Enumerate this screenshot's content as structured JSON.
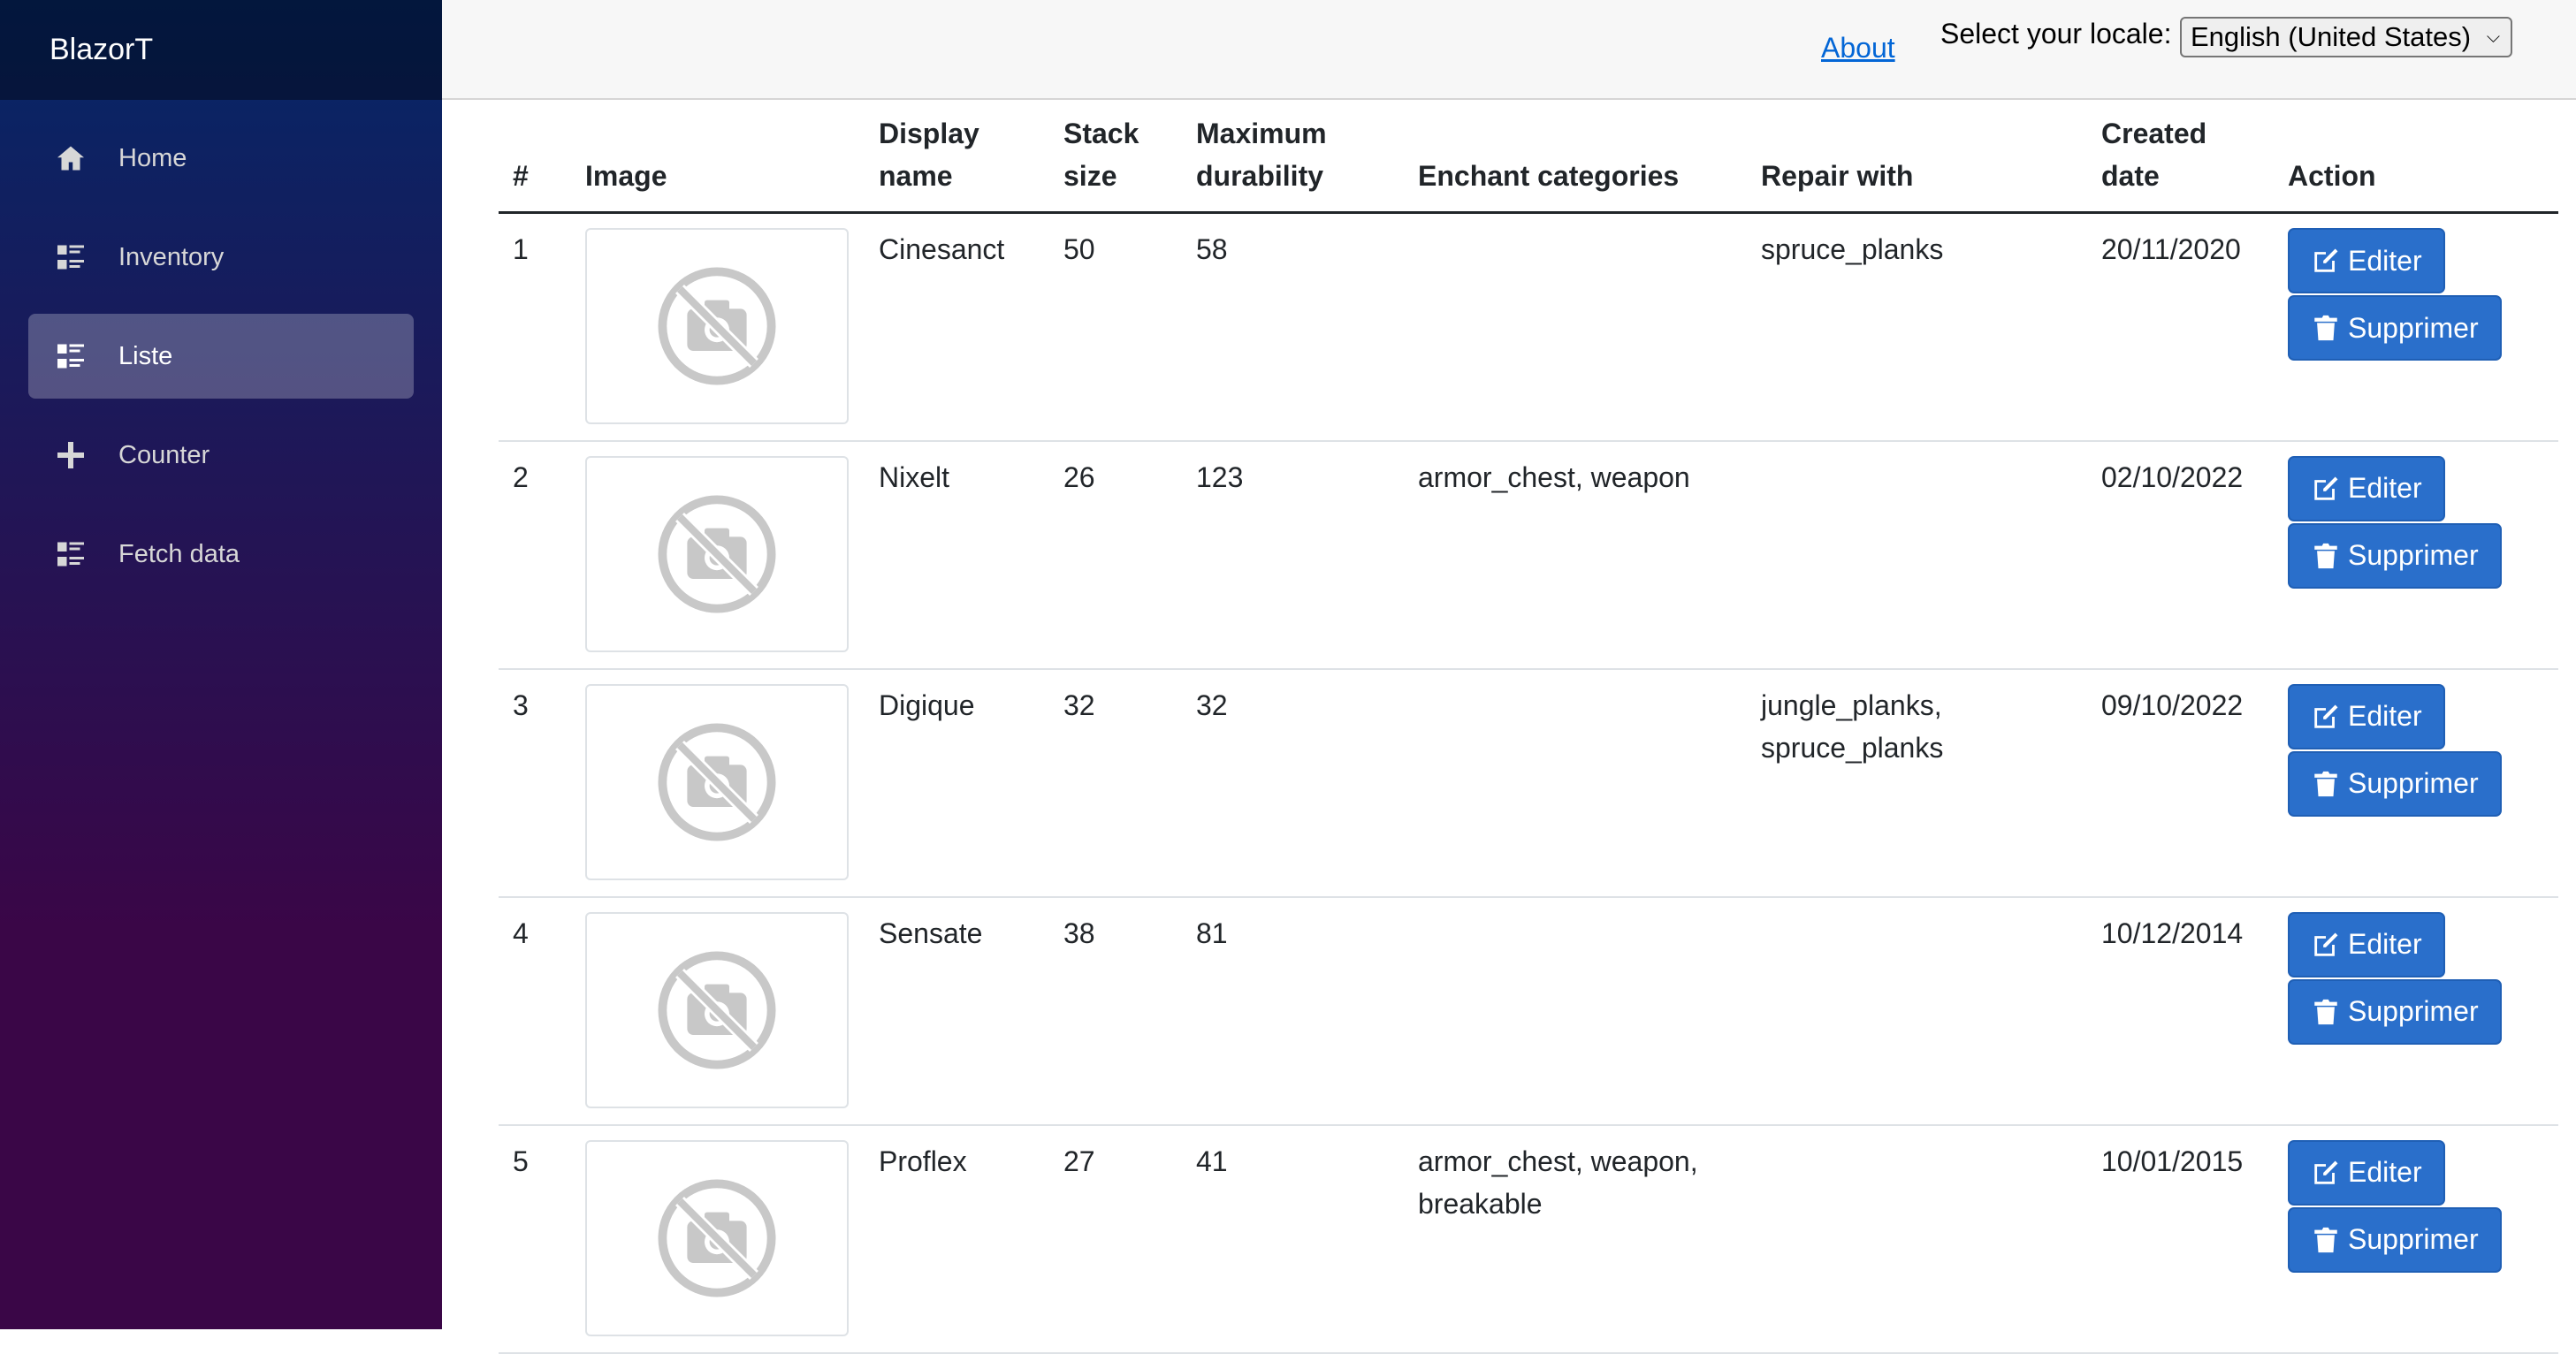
{
  "app": {
    "brand": "BlazorT"
  },
  "sidebar": {
    "items": [
      {
        "label": "Home",
        "icon": "home-icon",
        "active": false
      },
      {
        "label": "Inventory",
        "icon": "list-rich-icon",
        "active": false
      },
      {
        "label": "Liste",
        "icon": "list-rich-icon",
        "active": true
      },
      {
        "label": "Counter",
        "icon": "plus-icon",
        "active": false
      },
      {
        "label": "Fetch data",
        "icon": "list-rich-icon",
        "active": false
      }
    ]
  },
  "topbar": {
    "about": "About",
    "locale_label": "Select your locale:",
    "locale_value": "English (United States)"
  },
  "table": {
    "headers": {
      "num": "#",
      "image": "Image",
      "display_name": "Display name",
      "stack_size": "Stack size",
      "max_durability": "Maximum durability",
      "enchant": "Enchant categories",
      "repair": "Repair with",
      "created": "Created date",
      "action": "Action"
    },
    "edit_label": "Editer",
    "delete_label": "Supprimer",
    "rows": [
      {
        "num": "1",
        "name": "Cinesanct",
        "stack": "50",
        "durability": "58",
        "enchant": "",
        "repair": "spruce_planks",
        "created": "20/11/2020"
      },
      {
        "num": "2",
        "name": "Nixelt",
        "stack": "26",
        "durability": "123",
        "enchant": "armor_chest, weapon",
        "repair": "",
        "created": "02/10/2022"
      },
      {
        "num": "3",
        "name": "Digique",
        "stack": "32",
        "durability": "32",
        "enchant": "",
        "repair": "jungle_planks, spruce_planks",
        "created": "09/10/2022"
      },
      {
        "num": "4",
        "name": "Sensate",
        "stack": "38",
        "durability": "81",
        "enchant": "",
        "repair": "",
        "created": "10/12/2014"
      },
      {
        "num": "5",
        "name": "Proflex",
        "stack": "27",
        "durability": "41",
        "enchant": "armor_chest, weapon, breakable",
        "repair": "",
        "created": "10/01/2015"
      }
    ]
  },
  "colors": {
    "primary_button": "#2a6fcb",
    "link": "#0366d6",
    "sidebar_top": "#052767",
    "sidebar_bottom": "#3a0647"
  }
}
